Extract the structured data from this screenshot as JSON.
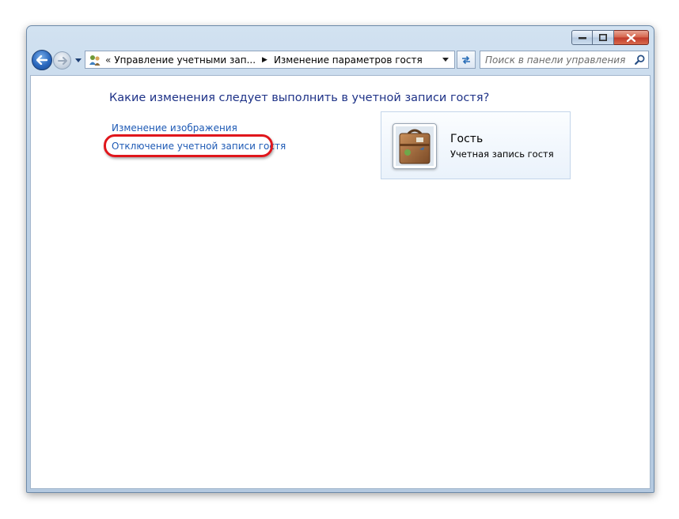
{
  "window": {
    "caption_buttons": [
      "minimize-icon",
      "maximize-icon",
      "close-icon"
    ],
    "colors": {
      "frame": "#c4d6ea",
      "close": "#c0392b"
    }
  },
  "nav": {
    "back_icon": "back-arrow-icon",
    "forward_icon": "forward-arrow-icon",
    "history_icon": "chevron-down-icon"
  },
  "address": {
    "chevron": "«",
    "crumbs": [
      "Управление учетными зап...",
      "Изменение параметров гостя"
    ],
    "location_icon": "users-icon"
  },
  "search": {
    "placeholder": "Поиск в панели управления"
  },
  "main": {
    "heading": "Какие изменения следует выполнить в учетной записи гостя?",
    "links": [
      {
        "label": "Изменение изображения"
      },
      {
        "label": "Отключение учетной записи гостя",
        "highlighted": true
      }
    ],
    "highlight_color": "#e0161c"
  },
  "account": {
    "name": "Гость",
    "type": "Учетная запись гостя",
    "picture_icon": "suitcase-icon"
  }
}
